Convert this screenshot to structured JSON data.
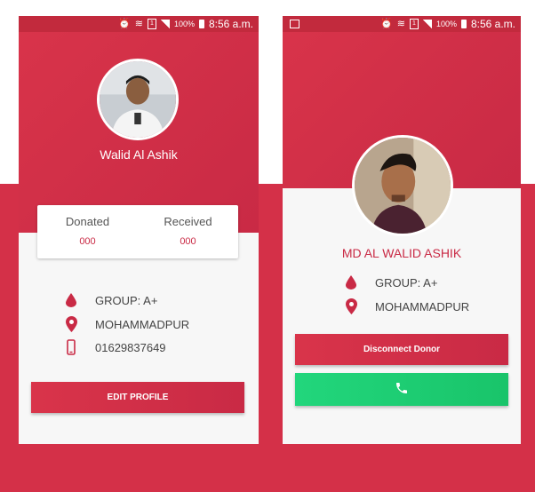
{
  "status_bar": {
    "battery": "100%",
    "time": "8:56 a.m."
  },
  "profile_screen": {
    "name": "Walid Al Ashik",
    "stats": [
      {
        "label": "Donated",
        "value": "000"
      },
      {
        "label": "Received",
        "value": "000"
      }
    ],
    "group": "GROUP:  A+",
    "location": "MOHAMMADPUR",
    "phone": "01629837649",
    "edit_button": "EDIT PROFILE"
  },
  "donor_screen": {
    "name": "MD AL WALID ASHIK",
    "group": "GROUP:  A+",
    "location": "MOHAMMADPUR",
    "disconnect_button": "Disconnect Donor"
  },
  "colors": {
    "primary": "#d43048",
    "accent_green": "#1ed074"
  }
}
